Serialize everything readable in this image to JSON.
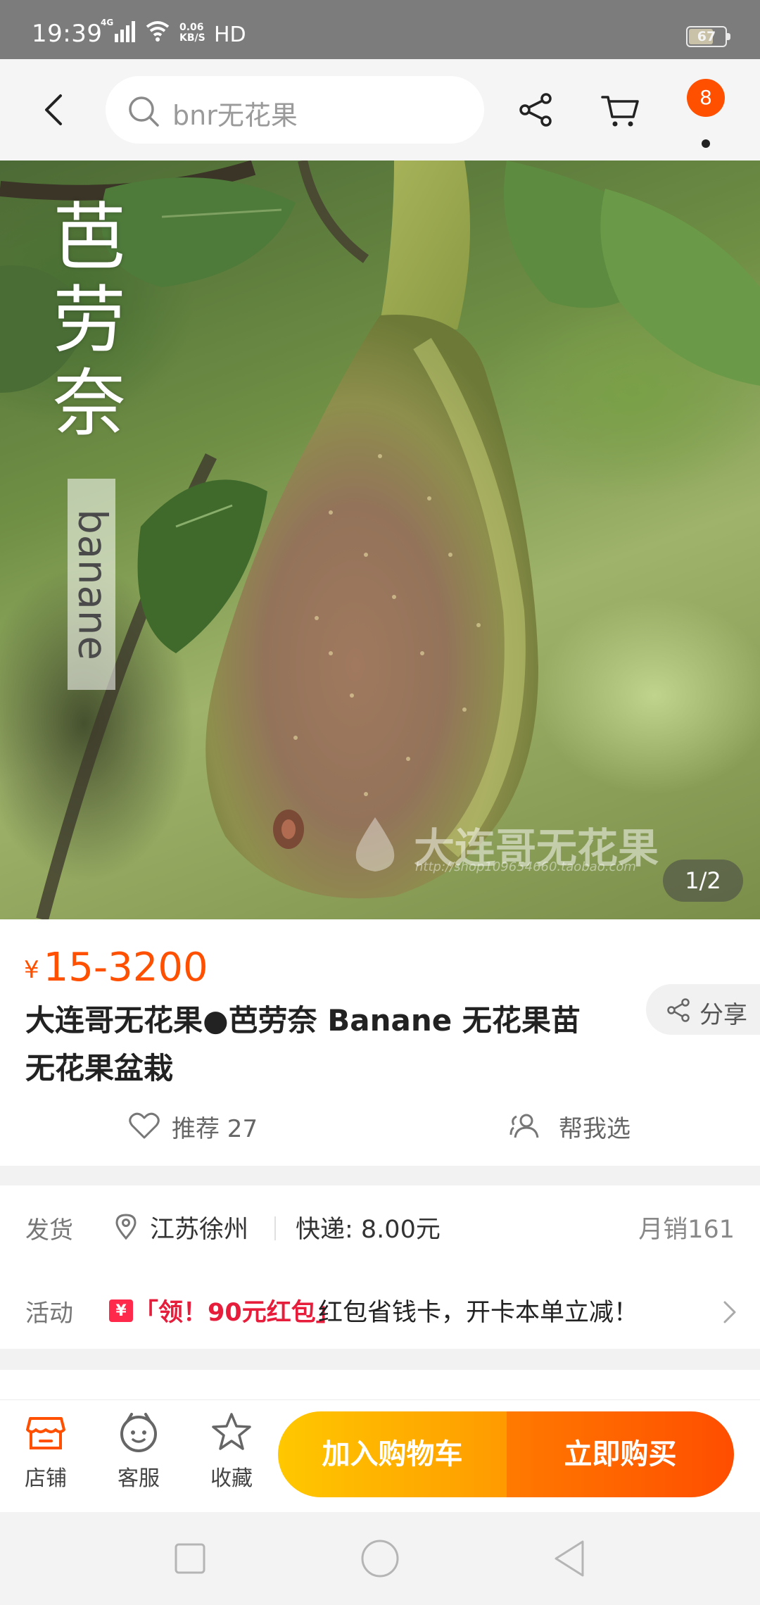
{
  "status_bar": {
    "time": "19:39",
    "network_type": "4G",
    "speed_value": "0.06",
    "speed_unit": "KB/S",
    "hd_label": "HD",
    "battery_level": "67",
    "battery_fraction": 0.67
  },
  "top_nav": {
    "search_text": "bnr无花果",
    "badge_count": "8"
  },
  "hero": {
    "title_cn": "芭劳奈",
    "title_en": "banane",
    "watermark": "大连哥无花果",
    "watermark_url": "http://shop109654660.taobao.com",
    "page_indicator": "1/2"
  },
  "product": {
    "currency_symbol": "¥",
    "price": "15-3200",
    "title": "大连哥无花果●芭劳奈 Banane 无花果苗 无花果盆栽",
    "share_label": "分享",
    "recommend_label": "推荐 27",
    "help_choose_label": "帮我选"
  },
  "details": {
    "ship_label": "发货",
    "ship_location": "江苏徐州",
    "ship_fee": "快递: 8.00元",
    "monthly_sales": "月销161",
    "activity_label": "活动",
    "activity_icon_text": "¥",
    "activity_promo": "「领！90元红包」",
    "activity_text": "红包省钱卡，开卡本单立减！"
  },
  "bottom_bar": {
    "store_label": "店铺",
    "service_label": "客服",
    "favorite_label": "收藏",
    "add_to_cart_label": "加入购物车",
    "buy_now_label": "立即购买"
  },
  "colors": {
    "accent": "#ff5000",
    "cart_button": "#ffb300",
    "buy_button": "#ff5a00",
    "promo_red": "#e61e3c"
  },
  "icons": [
    "back-arrow-icon",
    "search-icon",
    "share-icon",
    "cart-icon",
    "more-dot-icon",
    "heart-icon",
    "people-icon",
    "location-pin-icon",
    "chevron-right-icon",
    "store-icon",
    "customer-service-icon",
    "star-icon",
    "square-icon",
    "circle-icon",
    "triangle-back-icon"
  ]
}
